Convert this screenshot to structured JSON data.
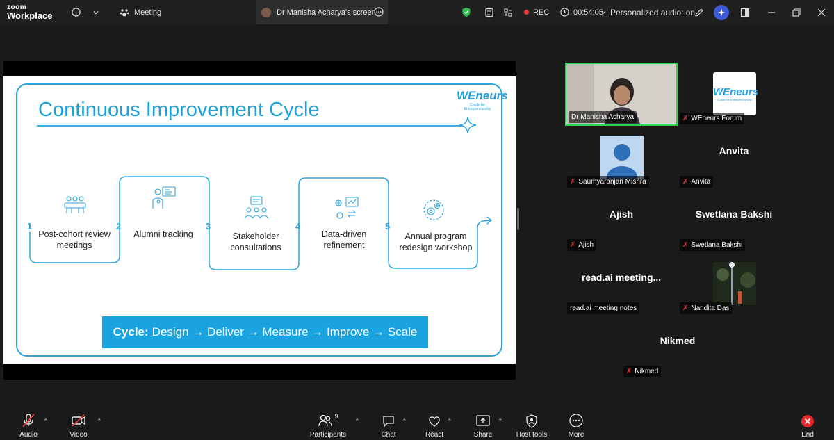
{
  "app": {
    "brand_top": "zoom",
    "brand_bottom": "Workplace"
  },
  "topbar": {
    "meeting_label": "Meeting",
    "share_tab_label": "Dr Manisha Acharya's screen",
    "rec_label": "REC",
    "timer": "00:54:05",
    "audio_label": "Personalized audio: on"
  },
  "slide": {
    "title": "Continuous Improvement Cycle",
    "logo_text": "WEneurs",
    "logo_tagline": "Cradle for Entrepreneurship",
    "steps": [
      {
        "num": "1",
        "label": "Post-cohort review meetings"
      },
      {
        "num": "2",
        "label": "Alumni tracking"
      },
      {
        "num": "3",
        "label": "Stakeholder consultations"
      },
      {
        "num": "4",
        "label": "Data-driven refinement"
      },
      {
        "num": "5",
        "label": "Annual program redesign workshop"
      }
    ],
    "cycle_label": "Cycle:",
    "cycle_text": "Design → Deliver → Measure → Improve → Scale"
  },
  "participants": [
    {
      "name": "Dr Manisha Acharya",
      "muted": false,
      "kind": "video"
    },
    {
      "name": "WEneurs Forum",
      "muted": true,
      "kind": "logo",
      "logo_text": "WEneurs",
      "logo_tagline": "Cradle for Entrepreneurship"
    },
    {
      "name": "Saumyaranjan Mishra",
      "muted": true,
      "kind": "avatar"
    },
    {
      "name": "Anvita",
      "muted": true,
      "kind": "name",
      "display": "Anvita"
    },
    {
      "name": "Ajish",
      "muted": true,
      "kind": "name",
      "display": "Ajish"
    },
    {
      "name": "Swetlana Bakshi",
      "muted": true,
      "kind": "name",
      "display": "Swetlana Bakshi"
    },
    {
      "name": "read.ai meeting notes",
      "muted": false,
      "kind": "name",
      "display": "read.ai  meeting..."
    },
    {
      "name": "Nandita Das",
      "muted": true,
      "kind": "photo"
    },
    {
      "name": "Nikmed",
      "muted": true,
      "kind": "name",
      "display": "Nikmed"
    }
  ],
  "bottombar": {
    "audio": "Audio",
    "video": "Video",
    "participants": "Participants",
    "participants_count": "9",
    "chat": "Chat",
    "react": "React",
    "share": "Share",
    "host_tools": "Host tools",
    "more": "More",
    "end": "End"
  },
  "colors": {
    "accent": "#1aa3df",
    "rec": "#e33b3b",
    "active_speaker": "#2fd15a",
    "bg": "#1a1a1a"
  }
}
